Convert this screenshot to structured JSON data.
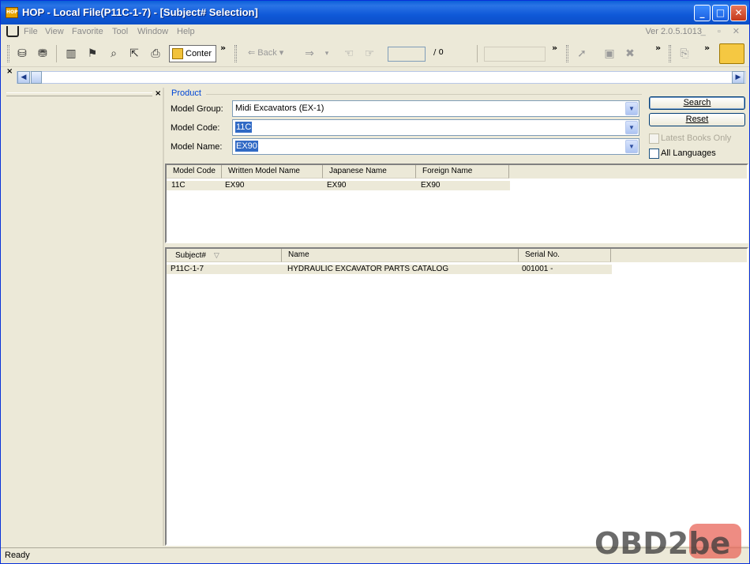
{
  "window": {
    "title": "HOP - Local File(P11C-1-7) - [Subject# Selection]",
    "app_icon_text": "HOP"
  },
  "menu": {
    "items": [
      "File",
      "View",
      "Favorite",
      "Tool",
      "Window",
      "Help"
    ],
    "version": "Ver 2.0.5.1013"
  },
  "toolbar": {
    "content_label": "Conter",
    "back_label": "Back",
    "page_total": "/ 0"
  },
  "product": {
    "legend": "Product",
    "model_group": {
      "label": "Model Group:",
      "value": "Midi Excavators (EX-1)"
    },
    "model_code": {
      "label": "Model Code:",
      "value": "11C"
    },
    "model_name": {
      "label": "Model Name:",
      "value": "EX90"
    },
    "search_label": "Search",
    "reset_label": "Reset",
    "latest_books_label": "Latest Books Only",
    "all_languages_label": "All Languages"
  },
  "models_table": {
    "headers": [
      "Model Code",
      "Written Model Name",
      "Japanese Name",
      "Foreign Name"
    ],
    "rows": [
      [
        "11C",
        "EX90",
        "EX90",
        "EX90"
      ]
    ]
  },
  "subjects_table": {
    "headers": [
      "Subject#",
      "Name",
      "Serial No."
    ],
    "rows": [
      [
        "P11C-1-7",
        "HYDRAULIC EXCAVATOR PARTS CATALOG",
        "001001 -"
      ]
    ]
  },
  "status": {
    "text": "Ready"
  },
  "watermark": {
    "text": "OBD2be"
  }
}
